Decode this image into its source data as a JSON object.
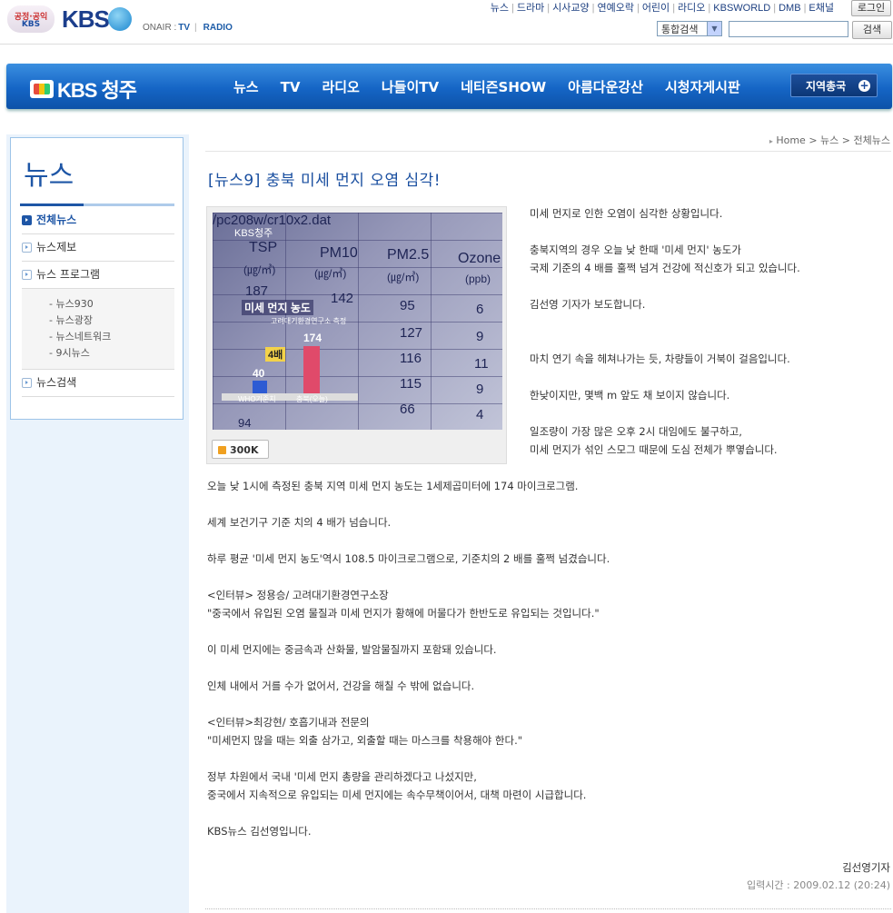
{
  "header": {
    "logo_public_line1": "공정·공익",
    "logo_public_line2": "KBS",
    "logo_brand": "KBS",
    "onair_label": "ONAIR :",
    "onair_tv": "TV",
    "onair_sep": "|",
    "onair_radio": "RADIO",
    "gnb": [
      "뉴스",
      "드라마",
      "시사교양",
      "연예오락",
      "어린이",
      "라디오",
      "KBSWORLD",
      "DMB",
      "E채널"
    ],
    "login_label": "로그인",
    "search_select": "통합검색",
    "search_value": "",
    "search_button": "검색"
  },
  "nav": {
    "logo_text": "KBS 청주",
    "menu": [
      "뉴스",
      "TV",
      "라디오",
      "나들이TV",
      "네티즌SHOW",
      "아름다운강산",
      "시청자게시판"
    ],
    "region_button": "지역총국",
    "region_plus": "+"
  },
  "sidebar": {
    "title": "뉴스",
    "items": [
      {
        "label": "전체뉴스"
      },
      {
        "label": "뉴스제보"
      },
      {
        "label": "뉴스 프로그램"
      },
      {
        "label": "뉴스검색"
      }
    ],
    "sub_items": [
      "- 뉴스930",
      "- 뉴스광장",
      "- 뉴스네트워크",
      "- 9시뉴스"
    ]
  },
  "breadcrumb": {
    "home": "Home",
    "sep": ">",
    "level1": "뉴스",
    "level2": "전체뉴스"
  },
  "article": {
    "title": "[뉴스9] 충북 미세 먼지 오염 심각!",
    "photo": {
      "header_text": "/pc208w/cr10x2.dat",
      "channel_tag": "KBS청주",
      "col_tsp": "TSP",
      "col_pm10": "PM10",
      "col_pm25": "PM2.5",
      "col_ozone": "Ozone",
      "col_unit": "(㎍/㎥)",
      "col_unit2": "(ppb)",
      "chart_title": "미세 먼지 농도",
      "chart_sub": "고려대기환경연구소 측정",
      "badge": "4배",
      "val_who": "40",
      "val_chungbuk": "174",
      "label_who": "WHO기준치",
      "label_chungbuk": "충북(오늘)",
      "row_vals": [
        "187",
        "142",
        "95",
        "6",
        "127",
        "9",
        "116",
        "11",
        "115",
        "9",
        "66",
        "4",
        "94"
      ]
    },
    "video_button": "300K",
    "paragraphs_side": [
      "미세 먼지로 인한 오염이 심각한 상황입니다.",
      "충북지역의 경우 오늘 낮 한때 '미세 먼지' 농도가",
      "국제 기준의 4 배를 훌쩍 넘겨 건강에 적신호가 되고 있습니다.",
      "김선영 기자가 보도합니다.",
      "마치 연기 속을 헤쳐나가는 듯, 차량들이 거북이 걸음입니다.",
      "한낮이지만, 몇백 m 앞도 채 보이지 않습니다.",
      "일조량이 가장 많은 오후 2시 대임에도 불구하고,",
      "미세 먼지가 섞인 스모그 때문에 도심 전체가 뿌옇습니다."
    ],
    "paragraphs_main": [
      "오늘 낮 1시에 측정된 충북 지역 미세 먼지 농도는 1세제곱미터에 174 마이크로그램.",
      "세계 보건기구 기준 치의 4 배가 넘습니다.",
      "하루 평균 '미세 먼지 농도'역시 108.5 마이크로그램으로, 기준치의 2 배를 훌쩍 넘겼습니다.",
      "<인터뷰> 정용승/ 고려대기환경연구소장",
      "\"중국에서 유입된 오염 물질과 미세 먼지가 황해에 머물다가 한반도로 유입되는 것입니다.\"",
      "이 미세 먼지에는 중금속과 산화물, 발암물질까지 포함돼 있습니다.",
      "인체 내에서 거를 수가 없어서, 건강을 해칠 수 밖에 없습니다.",
      "<인터뷰>최강현/ 호흡기내과 전문의",
      "\"미세먼지 많을 때는 외출 삼가고, 외출할 때는 마스크를 착용해야 한다.\"",
      "정부 차원에서 국내 '미세 먼지 총량을 관리하겠다고 나섰지만,",
      "중국에서 지속적으로 유입되는 미세 먼지에는 속수무책이어서, 대책 마련이 시급합니다.",
      "KBS뉴스 김선영입니다."
    ],
    "reporter": "김선영기자",
    "timestamp": "입력시간 : 2009.02.12 (20:24)"
  }
}
